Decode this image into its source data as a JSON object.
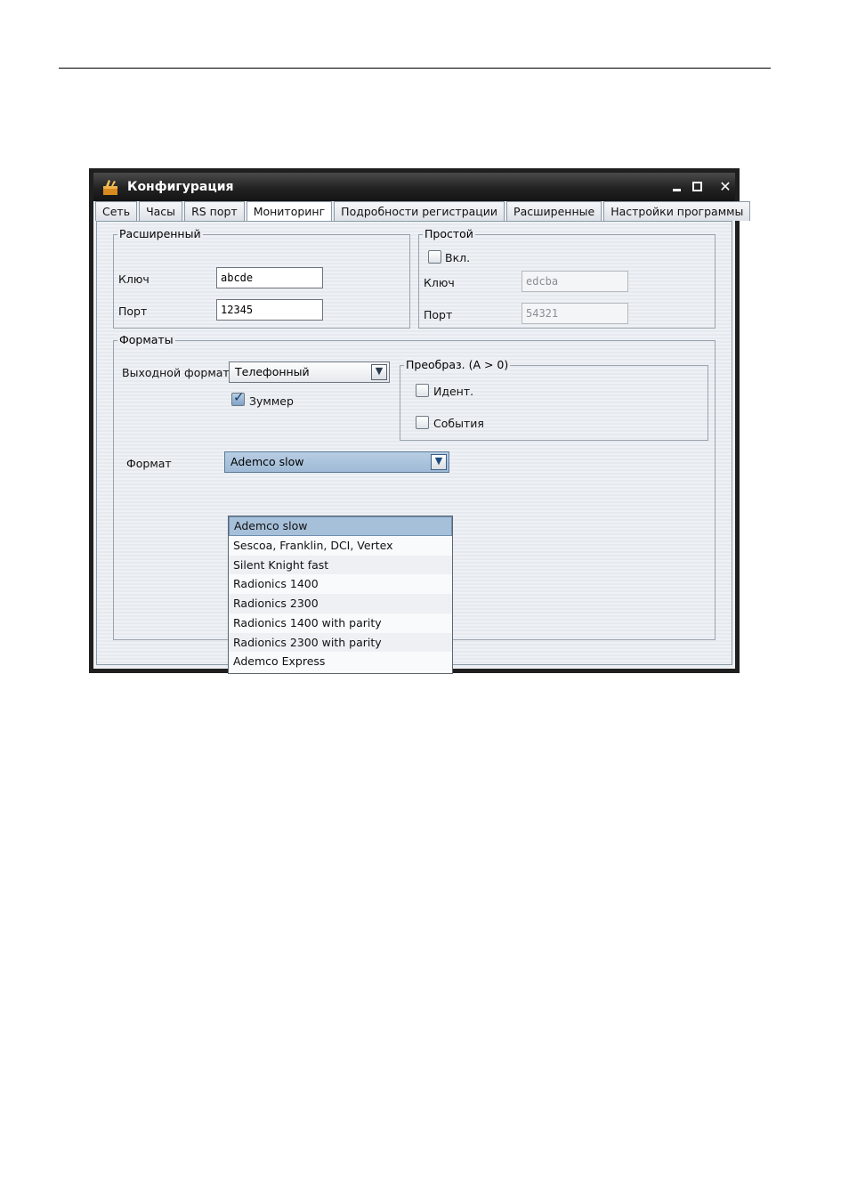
{
  "window": {
    "title": "Конфигурация",
    "minimize_icon": "minimize-icon",
    "maximize_icon": "maximize-icon",
    "close_icon": "close-icon"
  },
  "tabs": [
    {
      "label": "Сеть",
      "active": false
    },
    {
      "label": "Часы",
      "active": false
    },
    {
      "label": "RS порт",
      "active": false
    },
    {
      "label": "Мониторинг",
      "active": true
    },
    {
      "label": "Подробности регистрации",
      "active": false
    },
    {
      "label": "Расширенные",
      "active": false
    },
    {
      "label": "Настройки программы",
      "active": false
    }
  ],
  "extended": {
    "legend": "Расширенный",
    "key_label": "Ключ",
    "key_value": "abcde",
    "port_label": "Порт",
    "port_value": "12345"
  },
  "simple": {
    "legend": "Простой",
    "enable_label": "Вкл.",
    "enable_checked": false,
    "key_label": "Ключ",
    "key_value": "edcba",
    "port_label": "Порт",
    "port_value": "54321"
  },
  "formats": {
    "legend": "Форматы",
    "output_format_label": "Выходной формат",
    "output_format_value": "Телефонный",
    "buzzer_label": "Зуммер",
    "buzzer_checked": true,
    "convert": {
      "legend": "Преобраз. (A > 0)",
      "ident_label": "Идент.",
      "ident_checked": false,
      "events_label": "События",
      "events_checked": false
    },
    "format_label": "Формат",
    "format_value": "Ademco slow",
    "format_options": [
      "Ademco slow",
      "Sescoa, Franklin, DCI, Vertex",
      "Silent Knight fast",
      "Radionics 1400",
      "Radionics 2300",
      "Radionics 1400 with parity",
      "Radionics 2300 with parity",
      "Ademco Express"
    ],
    "format_selected_index": 0
  },
  "colors": {
    "titlebar": "#222222",
    "selection": "#a7c0da",
    "window_bg": "#eef0f3"
  }
}
